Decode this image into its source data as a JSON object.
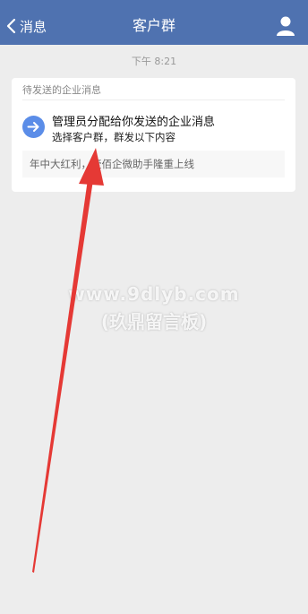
{
  "nav": {
    "back_label": "消息",
    "title": "客户群"
  },
  "timestamp": "下午 8:21",
  "card": {
    "header": "待发送的企业消息",
    "main_text": "管理员分配给你发送的企业消息",
    "sub_text": "选择客户群，群发以下内容",
    "preview": "年中大红利，壹佰企微助手隆重上线"
  },
  "watermark": {
    "line1": "www.9dlyb.com",
    "line2": "(玖鼎留言板)"
  },
  "colors": {
    "nav_bar": "#4f72b0",
    "arrow_icon_bg": "#5b8de8",
    "annotation_arrow": "#e53935",
    "background": "#ededed"
  }
}
